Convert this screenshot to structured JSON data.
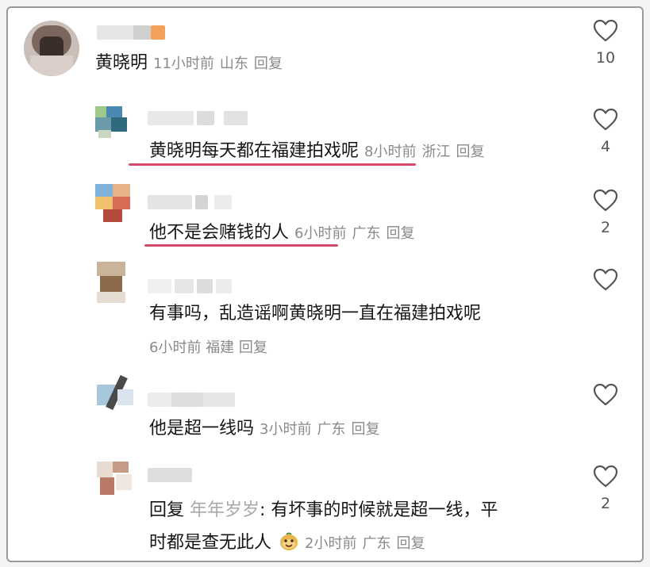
{
  "comments": [
    {
      "text": "黄晓明",
      "time": "11小时前",
      "location": "山东",
      "reply": "回复",
      "likes": "10"
    },
    {
      "text": "黄晓明每天都在福建拍戏呢",
      "time": "8小时前",
      "location": "浙江",
      "reply": "回复",
      "likes": "4"
    },
    {
      "text": "他不是会赌钱的人",
      "time": "6小时前",
      "location": "广东",
      "reply": "回复",
      "likes": "2"
    },
    {
      "text": "有事吗，乱造谣啊黄晓明一直在福建拍戏呢",
      "time": "6小时前",
      "location": "福建",
      "reply": "回复",
      "likes": ""
    },
    {
      "text": "他是超一线吗",
      "time": "3小时前",
      "location": "广东",
      "reply": "回复",
      "likes": ""
    },
    {
      "reply_prefix": "回复",
      "reply_to": "年年岁岁",
      "text_line1": ": 有坏事的时候就是超一线，平",
      "text_line2": "时都是查无此人",
      "time": "2小时前",
      "location": "广东",
      "reply": "回复",
      "likes": "2"
    }
  ],
  "icons": {
    "like": "heart-outline-icon",
    "emoji": "smiling-face-emoji-icon"
  },
  "colors": {
    "underline": "#d84a6b",
    "meta": "#8a8a8a",
    "reply_to": "#a8a8a8"
  }
}
